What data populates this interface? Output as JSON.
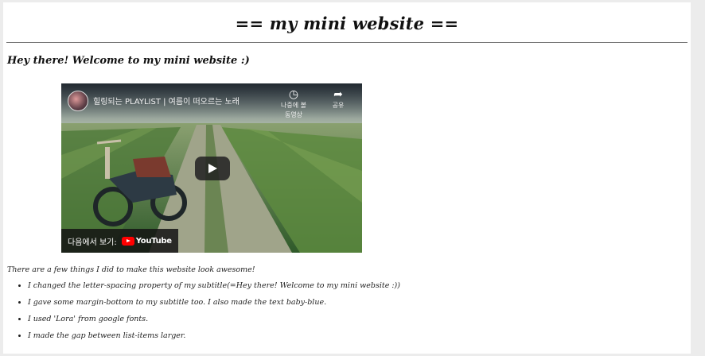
{
  "page": {
    "title": "== my mini website ==",
    "subtitle": "Hey there! Welcome to my mini website :)"
  },
  "video": {
    "title": "힐링되는 PLAYLIST | 여름이 떠오르는 노래",
    "watch_later_label": "나중에 볼 동영상",
    "share_label": "공유",
    "watch_on_label": "다음에서 보기:",
    "youtube_label": "YouTube"
  },
  "content": {
    "intro": "There are a few things I did to make this website look awesome!",
    "items": [
      "I changed the letter-spacing property of my subtitle(=Hey there! Welcome to my mini website :))",
      "I gave some margin-bottom to my subtitle too. I also made the text baby-blue.",
      "I used 'Lora' from google fonts.",
      "I made the gap between list-items larger."
    ]
  },
  "icons": {
    "watch_later": "clock-icon",
    "share": "share-icon",
    "play": "play-icon"
  },
  "colors": {
    "youtube_red": "#ff0000",
    "rule": "#777777"
  }
}
